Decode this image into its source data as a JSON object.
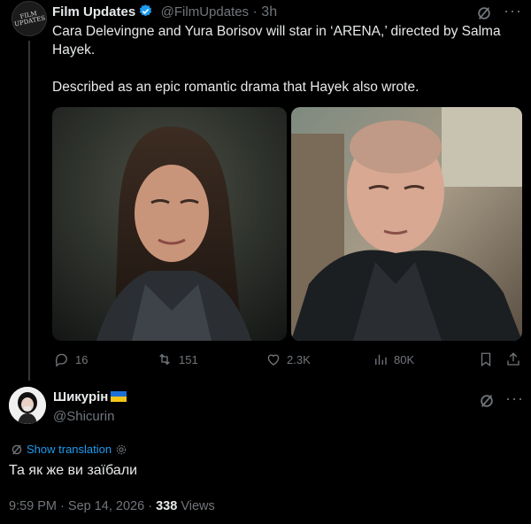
{
  "parent": {
    "avatar_text": "FILM UPDATES",
    "name": "Film Updates",
    "handle": "@FilmUpdates",
    "separator": "·",
    "time": "3h",
    "text_line1": "Cara Delevingne and Yura Borisov will star in ‘ARENA,’ directed by Salma Hayek.",
    "text_line2": "Described as an epic romantic drama that Hayek also wrote.",
    "stats": {
      "replies": "16",
      "reposts": "151",
      "likes": "2.3K",
      "views": "80K"
    }
  },
  "reply": {
    "name": "Шикурін",
    "handle": "@Shicurin",
    "translate_label": "Show translation",
    "text": "Та як же ви заїбали",
    "time": "9:59 PM",
    "separator": "·",
    "date": "Sep 14, 2026",
    "views_count": "338",
    "views_label": "Views"
  },
  "colors": {
    "accent": "#1d9bf0",
    "muted": "#71767b",
    "text": "#e7e9ea",
    "background": "#000000"
  }
}
